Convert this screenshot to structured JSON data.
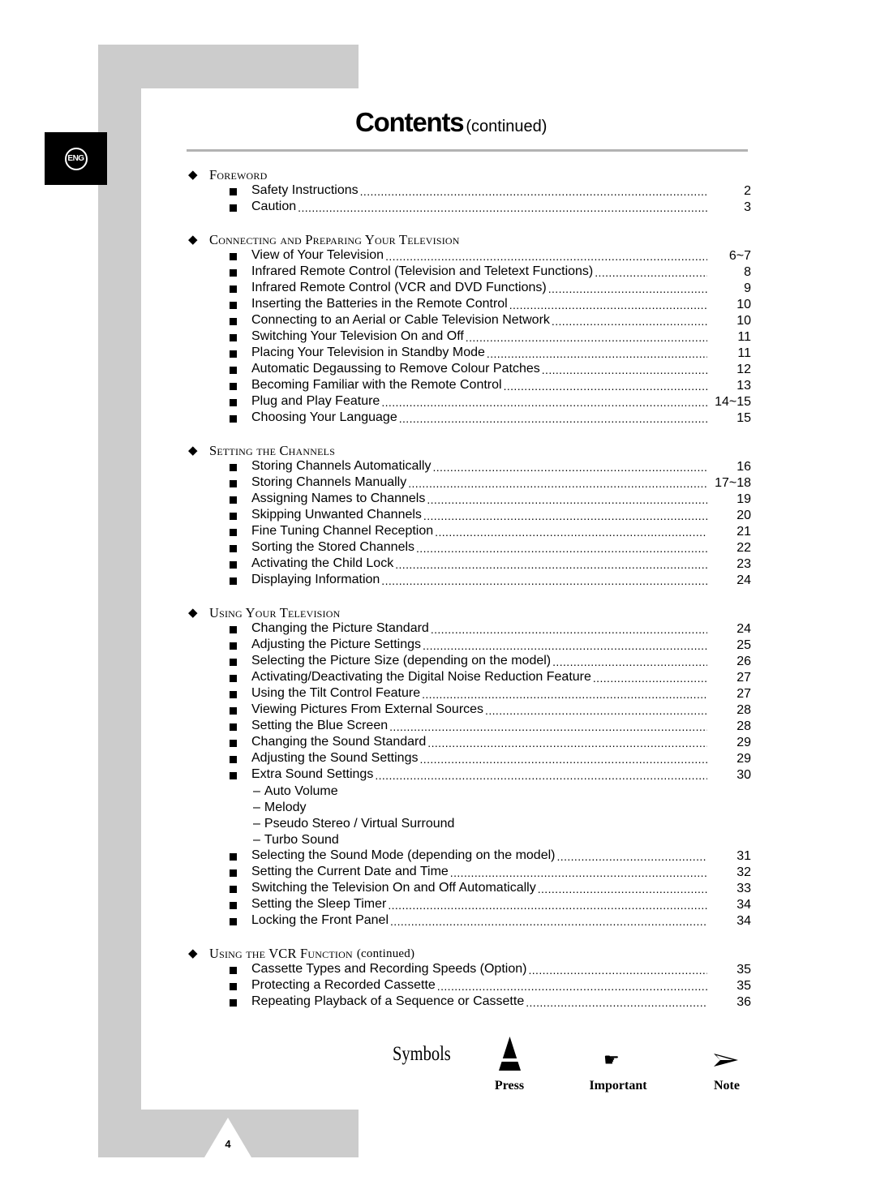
{
  "language_tab": "ENG",
  "title": {
    "main": "Contents",
    "sub": "(continued)"
  },
  "sections": [
    {
      "heading": "Foreword",
      "continued": "",
      "items": [
        {
          "label": "Safety Instructions",
          "page": "2"
        },
        {
          "label": "Caution",
          "page": "3"
        }
      ]
    },
    {
      "heading": "Connecting and Preparing Your Television",
      "continued": "",
      "items": [
        {
          "label": "View of Your Television",
          "page": "6~7"
        },
        {
          "label": "Infrared Remote Control (Television and Teletext Functions)",
          "page": "8"
        },
        {
          "label": "Infrared Remote Control (VCR and DVD Functions)",
          "page": "9"
        },
        {
          "label": "Inserting the Batteries in the Remote Control",
          "page": "10"
        },
        {
          "label": "Connecting to an Aerial or Cable Television Network",
          "page": "10"
        },
        {
          "label": "Switching Your Television On and Off",
          "page": "11"
        },
        {
          "label": "Placing Your Television in Standby Mode",
          "page": "11"
        },
        {
          "label": "Automatic Degaussing to Remove Colour Patches",
          "page": "12"
        },
        {
          "label": "Becoming Familiar with the Remote Control",
          "page": "13"
        },
        {
          "label": "Plug and Play Feature",
          "page": "14~15"
        },
        {
          "label": "Choosing Your Language",
          "page": "15"
        }
      ]
    },
    {
      "heading": "Setting the Channels",
      "continued": "",
      "items": [
        {
          "label": "Storing Channels Automatically",
          "page": "16"
        },
        {
          "label": "Storing Channels Manually",
          "page": "17~18"
        },
        {
          "label": "Assigning Names to Channels",
          "page": "19"
        },
        {
          "label": "Skipping Unwanted Channels",
          "page": "20"
        },
        {
          "label": "Fine Tuning Channel Reception",
          "page": "21"
        },
        {
          "label": "Sorting the Stored Channels",
          "page": "22"
        },
        {
          "label": "Activating the Child Lock",
          "page": "23"
        },
        {
          "label": "Displaying Information",
          "page": "24"
        }
      ]
    },
    {
      "heading": "Using Your Television",
      "continued": "",
      "items": [
        {
          "label": "Changing the Picture Standard",
          "page": "24"
        },
        {
          "label": "Adjusting the Picture Settings",
          "page": "25"
        },
        {
          "label": "Selecting the Picture Size (depending on the model)",
          "page": "26"
        },
        {
          "label": "Activating/Deactivating the Digital Noise Reduction Feature",
          "page": "27"
        },
        {
          "label": "Using the Tilt Control Feature",
          "page": "27"
        },
        {
          "label": "Viewing Pictures From External Sources",
          "page": "28"
        },
        {
          "label": "Setting the Blue Screen",
          "page": "28"
        },
        {
          "label": "Changing the Sound Standard",
          "page": "29"
        },
        {
          "label": "Adjusting the Sound Settings",
          "page": "29"
        },
        {
          "label": "Extra Sound Settings",
          "page": "30",
          "subitems": [
            "Auto Volume",
            "Melody",
            "Pseudo Stereo / Virtual Surround",
            "Turbo Sound"
          ]
        },
        {
          "label": "Selecting the Sound Mode (depending on the model)",
          "page": "31"
        },
        {
          "label": "Setting the Current Date and Time",
          "page": "32"
        },
        {
          "label": "Switching the Television On and Off Automatically",
          "page": "33"
        },
        {
          "label": "Setting the Sleep Timer",
          "page": "34"
        },
        {
          "label": "Locking the Front Panel",
          "page": "34"
        }
      ]
    },
    {
      "heading": "Using the VCR Function",
      "continued": "(continued)",
      "items": [
        {
          "label": "Cassette Types and Recording Speeds (Option)",
          "page": "35"
        },
        {
          "label": "Protecting a Recorded Cassette",
          "page": "35"
        },
        {
          "label": "Repeating Playback of a Sequence or Cassette",
          "page": "36"
        }
      ]
    }
  ],
  "symbols": {
    "title": "Symbols",
    "items": [
      {
        "icon": "press-icon",
        "label": "Press"
      },
      {
        "icon": "important-icon",
        "label": "Important"
      },
      {
        "icon": "note-icon",
        "label": "Note"
      }
    ]
  },
  "page_number": "4"
}
